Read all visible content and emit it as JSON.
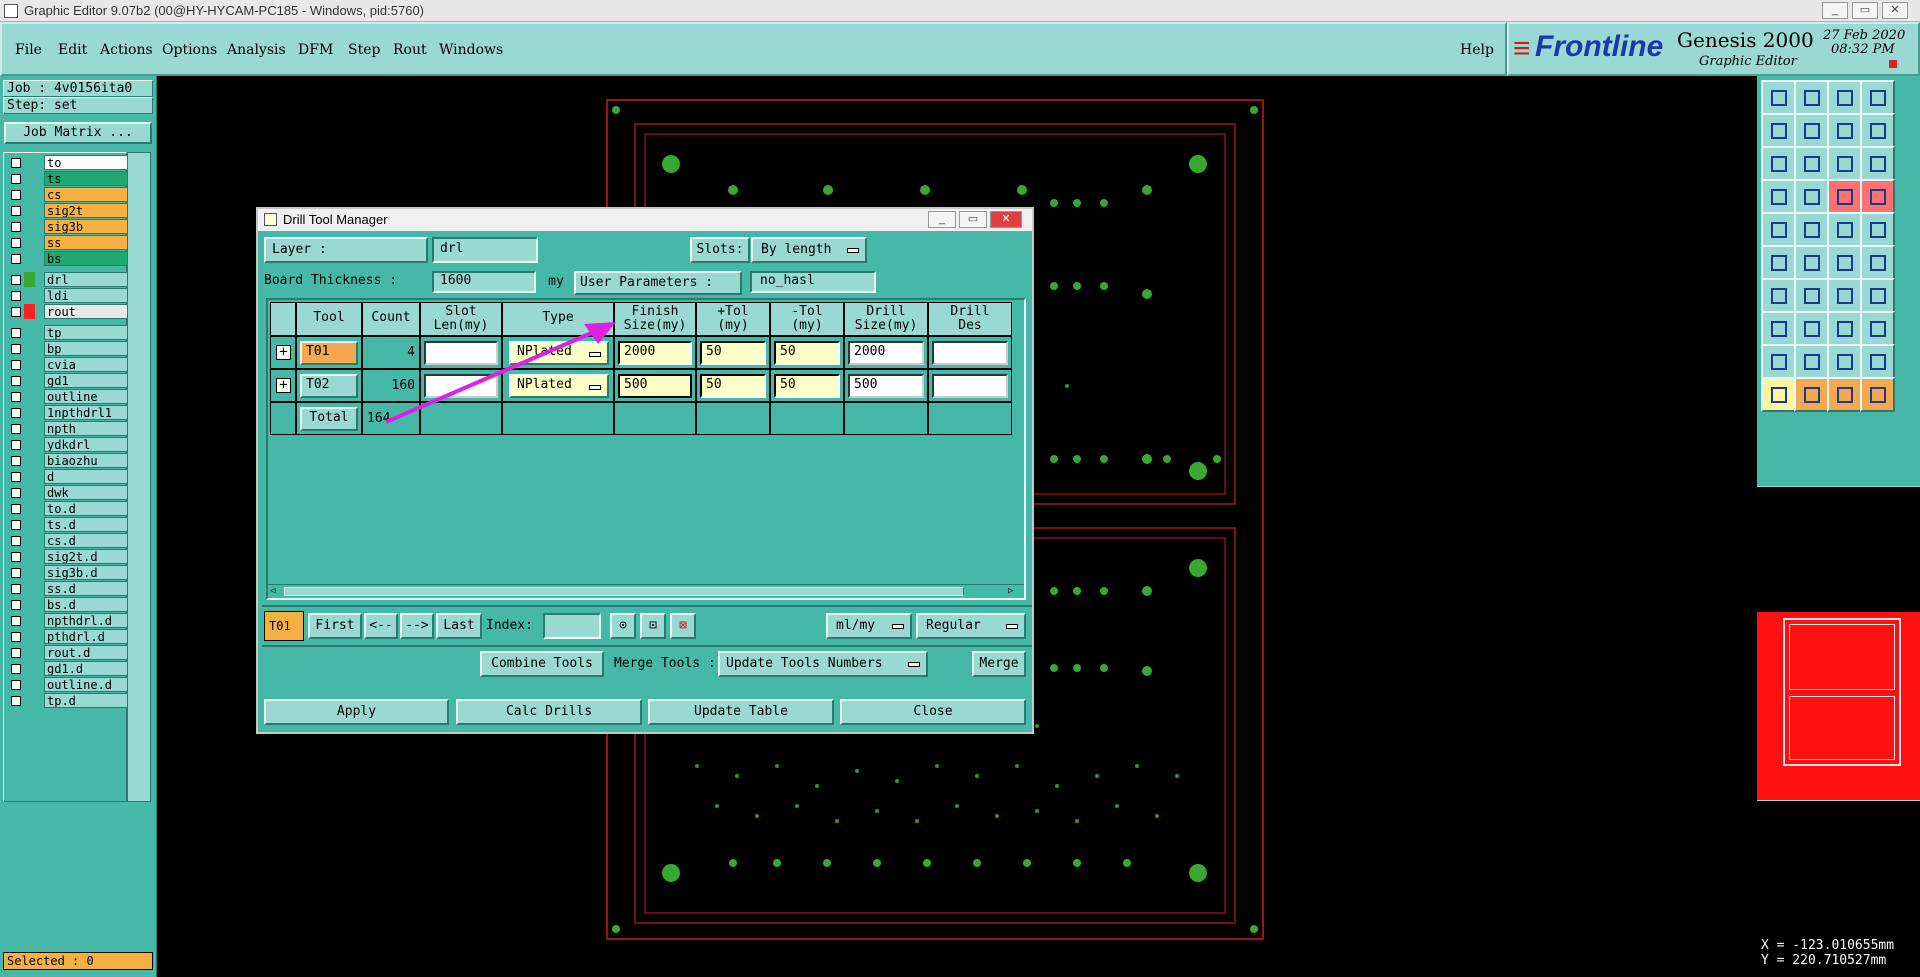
{
  "window": {
    "title": "Graphic Editor 9.07b2 (00@HY-HYCAM-PC185 - Windows, pid:5760)"
  },
  "menu": [
    "File",
    "Edit",
    "Actions",
    "Options",
    "Analysis",
    "DFM",
    "Step",
    "Rout",
    "Windows"
  ],
  "help": "Help",
  "brand": {
    "logo": "Frontline",
    "product": "Genesis 2000",
    "sub": "Graphic Editor",
    "date": "27 Feb 2020",
    "time": "08:32 PM"
  },
  "job": {
    "job": "Job : 4v0156ita0",
    "step": "Step: set",
    "matrix_btn": "Job Matrix ..."
  },
  "layers_top": [
    {
      "name": "to",
      "color": "#ffffff"
    },
    {
      "name": "ts",
      "color": "#20a870"
    },
    {
      "name": "cs",
      "color": "#f4b040"
    },
    {
      "name": "sig2t",
      "color": "#f4b040"
    },
    {
      "name": "sig3b",
      "color": "#f4b040"
    },
    {
      "name": "ss",
      "color": "#f4b040"
    },
    {
      "name": "bs",
      "color": "#20a870"
    }
  ],
  "layers_drill": [
    {
      "name": "drl",
      "color": "#9ad8d4",
      "swatch": "#38a830"
    },
    {
      "name": "ldi",
      "color": "#9ad8d4",
      "swatch": ""
    },
    {
      "name": "rout",
      "color": "#e8e8e8",
      "swatch": "#ff2020"
    }
  ],
  "layers_misc": [
    "tp",
    "bp",
    "cvia",
    "gd1",
    "outline",
    "1npthdrl1",
    "npth",
    "ydkdrl",
    "biaozhu",
    "d",
    "dwk",
    "to.d",
    "ts.d",
    "cs.d",
    "sig2t.d",
    "sig3b.d",
    "ss.d",
    "bs.d",
    "npthdrl.d",
    "pthdrl.d",
    "rout.d",
    "gd1.d",
    "outline.d",
    "tp.d"
  ],
  "selected": "Selected : 0",
  "coords": {
    "x": "X = -123.010655mm",
    "y": "Y = 220.710527mm"
  },
  "dialog": {
    "title": "Drill Tool Manager",
    "layer_label": "Layer             :",
    "layer_value": "drl",
    "slots_label": "Slots:",
    "slots_value": "By length",
    "thickness_label": "Board Thickness :",
    "thickness_value": "1600",
    "thickness_unit": "my",
    "userparams_label": "User Parameters  :",
    "userparams_value": "no_hasl",
    "columns": [
      "Tool",
      "Count",
      "Slot\nLen(my)",
      "Type",
      "Finish\nSize(my)",
      "+Tol\n(my)",
      "-Tol\n(my)",
      "Drill\nSize(my)",
      "Drill\nDes"
    ],
    "rows": [
      {
        "tool": "T01",
        "count": "4",
        "slot": "",
        "type": "NPlated",
        "finish": "2000",
        "ptol": "50",
        "mtol": "50",
        "drill": "2000",
        "des": ""
      },
      {
        "tool": "T02",
        "count": "160",
        "slot": "",
        "type": "NPlated",
        "finish": "500",
        "ptol": "50",
        "mtol": "50",
        "drill": "500",
        "des": ""
      }
    ],
    "total_label": "Total",
    "total_count": "164",
    "nav": {
      "current": "T01",
      "first": "First",
      "prev": "<--",
      "next": "-->",
      "last": "Last",
      "index_label": "Index:"
    },
    "units": "ml/my",
    "mode": "Regular",
    "combine": "Combine Tools",
    "merge_label": "Merge Tools :",
    "update_numbers": "Update Tools Numbers",
    "merge": "Merge",
    "apply": "Apply",
    "calc": "Calc Drills",
    "update_table": "Update Table",
    "close": "Close"
  }
}
